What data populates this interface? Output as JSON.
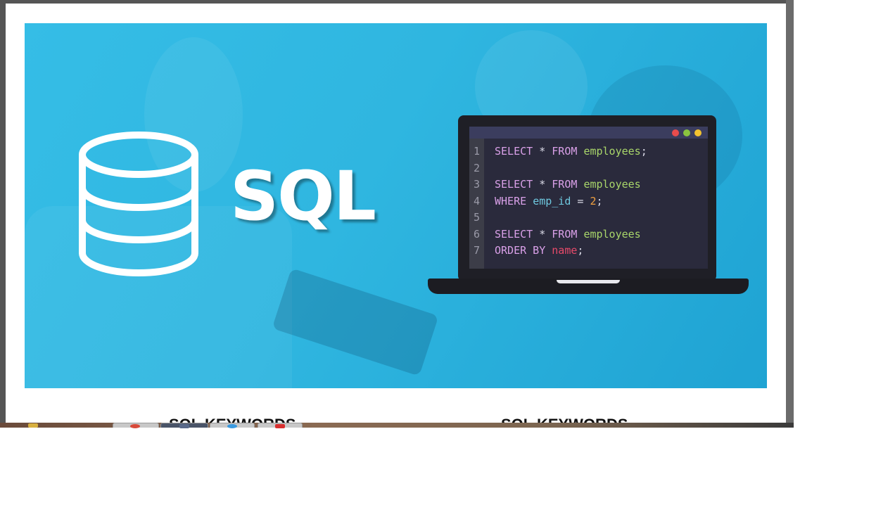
{
  "banner": {
    "logo_text": "SQL",
    "editor": {
      "lines": [
        {
          "num": "1",
          "tokens": [
            {
              "t": "SELECT",
              "c": "kw"
            },
            {
              "t": " * ",
              "c": "op"
            },
            {
              "t": "FROM",
              "c": "kw"
            },
            {
              "t": " ",
              "c": "op"
            },
            {
              "t": "employees",
              "c": "id"
            },
            {
              "t": ";",
              "c": "op"
            }
          ]
        },
        {
          "num": "2",
          "tokens": []
        },
        {
          "num": "3",
          "tokens": [
            {
              "t": "SELECT",
              "c": "kw"
            },
            {
              "t": " * ",
              "c": "op"
            },
            {
              "t": "FROM",
              "c": "kw"
            },
            {
              "t": " ",
              "c": "op"
            },
            {
              "t": "employees",
              "c": "id"
            }
          ]
        },
        {
          "num": "4",
          "tokens": [
            {
              "t": "WHERE",
              "c": "kw"
            },
            {
              "t": " ",
              "c": "op"
            },
            {
              "t": "emp_id",
              "c": "col"
            },
            {
              "t": " = ",
              "c": "op"
            },
            {
              "t": "2",
              "c": "numv"
            },
            {
              "t": ";",
              "c": "op"
            }
          ]
        },
        {
          "num": "5",
          "tokens": []
        },
        {
          "num": "6",
          "tokens": [
            {
              "t": "SELECT",
              "c": "kw"
            },
            {
              "t": " * ",
              "c": "op"
            },
            {
              "t": "FROM",
              "c": "kw"
            },
            {
              "t": " ",
              "c": "op"
            },
            {
              "t": "employees",
              "c": "id"
            }
          ]
        },
        {
          "num": "7",
          "tokens": [
            {
              "t": "ORDER BY",
              "c": "kw"
            },
            {
              "t": " ",
              "c": "op"
            },
            {
              "t": "name",
              "c": "nm"
            },
            {
              "t": ";",
              "c": "op"
            }
          ]
        }
      ]
    }
  },
  "captions": {
    "left": "SQL KEYWORDS",
    "right": "SQL KEYWORDS"
  },
  "taskbar": {
    "items": [
      {
        "name": "start",
        "icon": "folder-icon",
        "color": "#d8b040"
      },
      {
        "name": "chrome",
        "icon": "browser-icon",
        "color": "#d84a3a"
      },
      {
        "name": "app2",
        "icon": "window-icon",
        "color": "#5a6a8a"
      },
      {
        "name": "ie",
        "icon": "ie-icon",
        "color": "#3a9ae0"
      },
      {
        "name": "pdf",
        "icon": "pdf-icon",
        "color": "#d83030"
      }
    ]
  }
}
